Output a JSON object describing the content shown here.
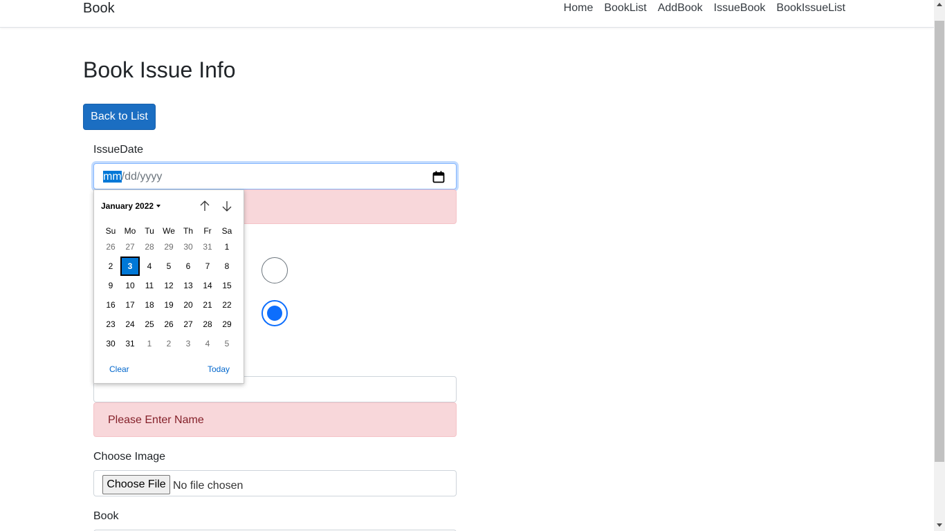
{
  "navbar": {
    "brand": "Book",
    "links": [
      {
        "label": "Home"
      },
      {
        "label": "BookList"
      },
      {
        "label": "AddBook"
      },
      {
        "label": "IssueBook"
      },
      {
        "label": "BookIssueList"
      }
    ]
  },
  "page": {
    "title": "Book Issue Info",
    "back_button": "Back to List"
  },
  "form": {
    "issue_date_label": "IssueDate",
    "issue_date_placeholder_sel": "mm",
    "issue_date_placeholder_rest": "/dd/yyyy",
    "name_error": "Please Enter Name",
    "choose_image_label": "Choose Image",
    "choose_file_button": "Choose File",
    "no_file_text": "No file chosen",
    "book_label": "Book",
    "radios": [
      {
        "checked": false
      },
      {
        "checked": true
      }
    ]
  },
  "datepicker": {
    "month_year": "January 2022",
    "weekdays": [
      "Su",
      "Mo",
      "Tu",
      "We",
      "Th",
      "Fr",
      "Sa"
    ],
    "weeks": [
      [
        {
          "d": "26",
          "o": true
        },
        {
          "d": "27",
          "o": true
        },
        {
          "d": "28",
          "o": true
        },
        {
          "d": "29",
          "o": true
        },
        {
          "d": "30",
          "o": true
        },
        {
          "d": "31",
          "o": true
        },
        {
          "d": "1",
          "o": false
        }
      ],
      [
        {
          "d": "2",
          "o": false
        },
        {
          "d": "3",
          "o": false,
          "s": true
        },
        {
          "d": "4",
          "o": false
        },
        {
          "d": "5",
          "o": false
        },
        {
          "d": "6",
          "o": false
        },
        {
          "d": "7",
          "o": false
        },
        {
          "d": "8",
          "o": false
        }
      ],
      [
        {
          "d": "9",
          "o": false
        },
        {
          "d": "10",
          "o": false
        },
        {
          "d": "11",
          "o": false
        },
        {
          "d": "12",
          "o": false
        },
        {
          "d": "13",
          "o": false
        },
        {
          "d": "14",
          "o": false
        },
        {
          "d": "15",
          "o": false
        }
      ],
      [
        {
          "d": "16",
          "o": false
        },
        {
          "d": "17",
          "o": false
        },
        {
          "d": "18",
          "o": false
        },
        {
          "d": "19",
          "o": false
        },
        {
          "d": "20",
          "o": false
        },
        {
          "d": "21",
          "o": false
        },
        {
          "d": "22",
          "o": false
        }
      ],
      [
        {
          "d": "23",
          "o": false
        },
        {
          "d": "24",
          "o": false
        },
        {
          "d": "25",
          "o": false
        },
        {
          "d": "26",
          "o": false
        },
        {
          "d": "27",
          "o": false
        },
        {
          "d": "28",
          "o": false
        },
        {
          "d": "29",
          "o": false
        }
      ],
      [
        {
          "d": "30",
          "o": false
        },
        {
          "d": "31",
          "o": false
        },
        {
          "d": "1",
          "o": true
        },
        {
          "d": "2",
          "o": true
        },
        {
          "d": "3",
          "o": true
        },
        {
          "d": "4",
          "o": true
        },
        {
          "d": "5",
          "o": true
        }
      ]
    ],
    "clear_label": "Clear",
    "today_label": "Today"
  }
}
